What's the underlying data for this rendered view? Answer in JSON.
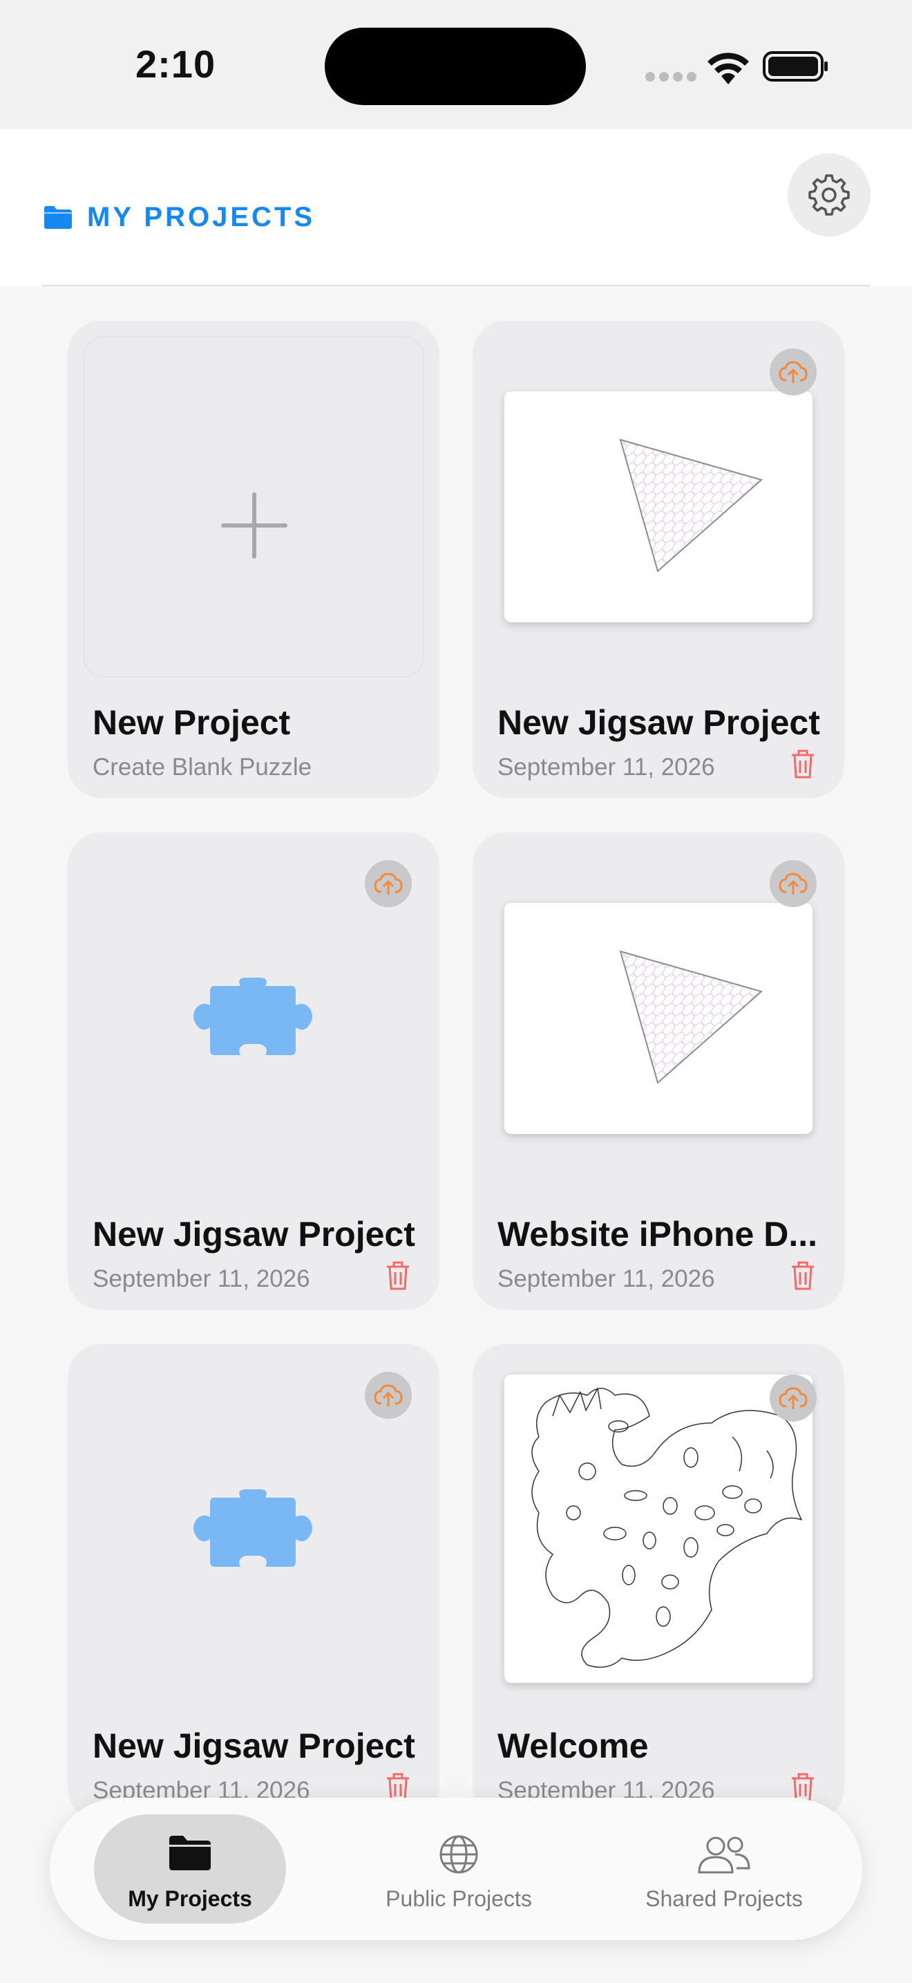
{
  "status_bar": {
    "time": "2:10"
  },
  "header": {
    "title": "MY PROJECTS",
    "accent_color": "#1688f2",
    "settings_icon": "gear-icon"
  },
  "projects": [
    {
      "title": "New Project",
      "subtitle": "Create Blank Puzzle",
      "kind": "new",
      "icon": "plus-icon"
    },
    {
      "title": "New Jigsaw Project",
      "subtitle": "September 11, 2026",
      "kind": "triangle-thumbnail",
      "cloud_icon": "cloud-upload-icon",
      "delete_icon": "trash-icon"
    },
    {
      "title": "New Jigsaw Project",
      "subtitle": "September 11, 2026",
      "kind": "puzzle-placeholder",
      "cloud_icon": "cloud-upload-icon",
      "delete_icon": "trash-icon"
    },
    {
      "title": "Website iPhone D...",
      "subtitle": "September 11, 2026",
      "kind": "triangle-thumbnail",
      "cloud_icon": "cloud-upload-icon",
      "delete_icon": "trash-icon"
    },
    {
      "title": "New Jigsaw Project",
      "subtitle": "September 11, 2026",
      "kind": "puzzle-placeholder",
      "cloud_icon": "cloud-upload-icon",
      "delete_icon": "trash-icon"
    },
    {
      "title": "Welcome",
      "subtitle": "September 11, 2026",
      "kind": "dragon-thumbnail",
      "cloud_icon": "cloud-upload-icon",
      "delete_icon": "trash-icon"
    }
  ],
  "colors": {
    "delete": "#f26a6a",
    "cloud": "#f28a3a",
    "puzzle": "#7ab8f5"
  },
  "tab_bar": {
    "tabs": [
      {
        "label": "My Projects",
        "icon": "folder-icon",
        "active": true
      },
      {
        "label": "Public Projects",
        "icon": "globe-icon",
        "active": false
      },
      {
        "label": "Shared Projects",
        "icon": "people-icon",
        "active": false
      }
    ]
  }
}
